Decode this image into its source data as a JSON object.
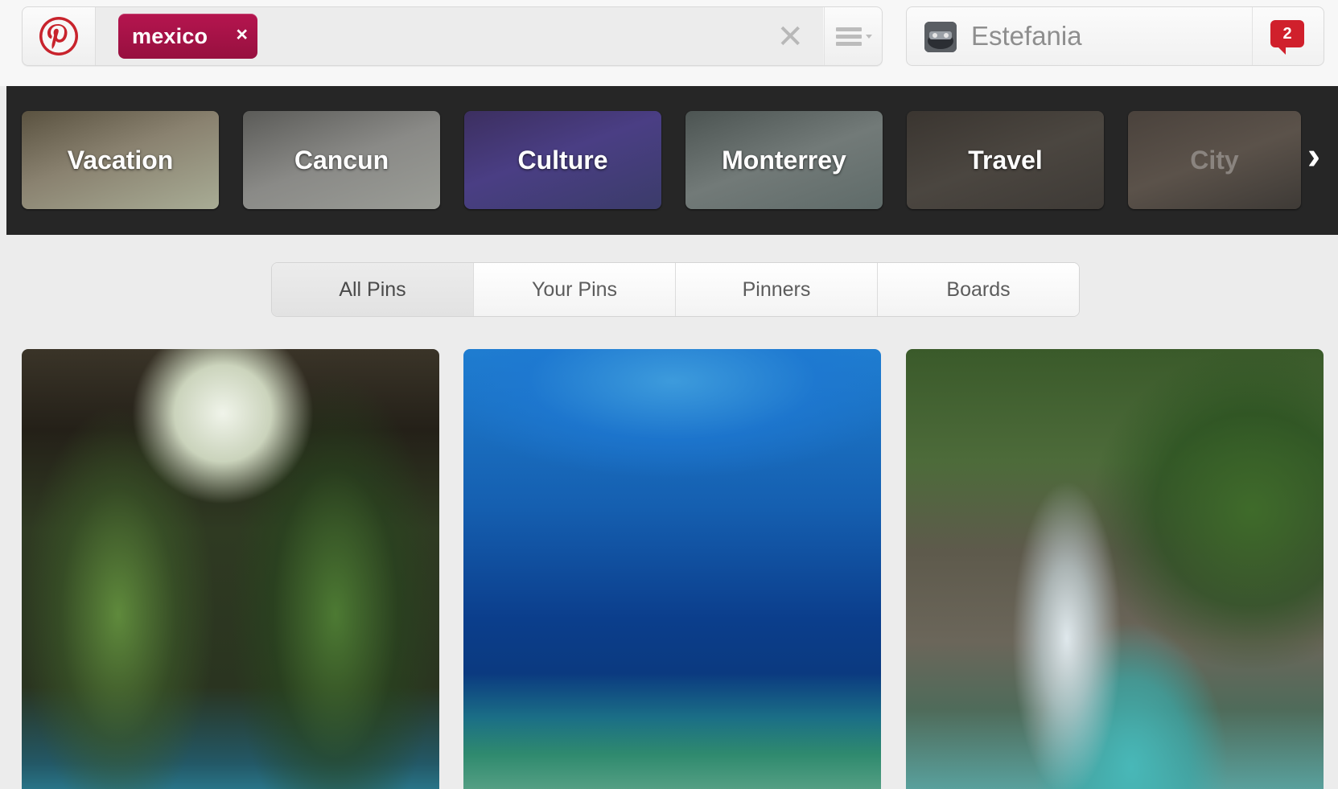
{
  "search": {
    "chip_label": "mexico",
    "chip_remove": "×",
    "clear": "✕"
  },
  "user": {
    "name": "Estefania",
    "notifications": "2"
  },
  "guides": {
    "items": [
      {
        "label": "Vacation"
      },
      {
        "label": "Cancun"
      },
      {
        "label": "Culture"
      },
      {
        "label": "Monterrey"
      },
      {
        "label": "Travel"
      },
      {
        "label": "City"
      }
    ],
    "next": "›"
  },
  "tabs": [
    {
      "label": "All Pins"
    },
    {
      "label": "Your Pins"
    },
    {
      "label": "Pinners"
    },
    {
      "label": "Boards"
    }
  ],
  "colors": {
    "brand": "#bd081c",
    "chip": "#a8134a",
    "notification": "#d0202c",
    "guide_bar": "#262626"
  },
  "pins": [
    {
      "icon": "cenote-photo"
    },
    {
      "icon": "underwater-photo"
    },
    {
      "icon": "river-photo"
    }
  ]
}
